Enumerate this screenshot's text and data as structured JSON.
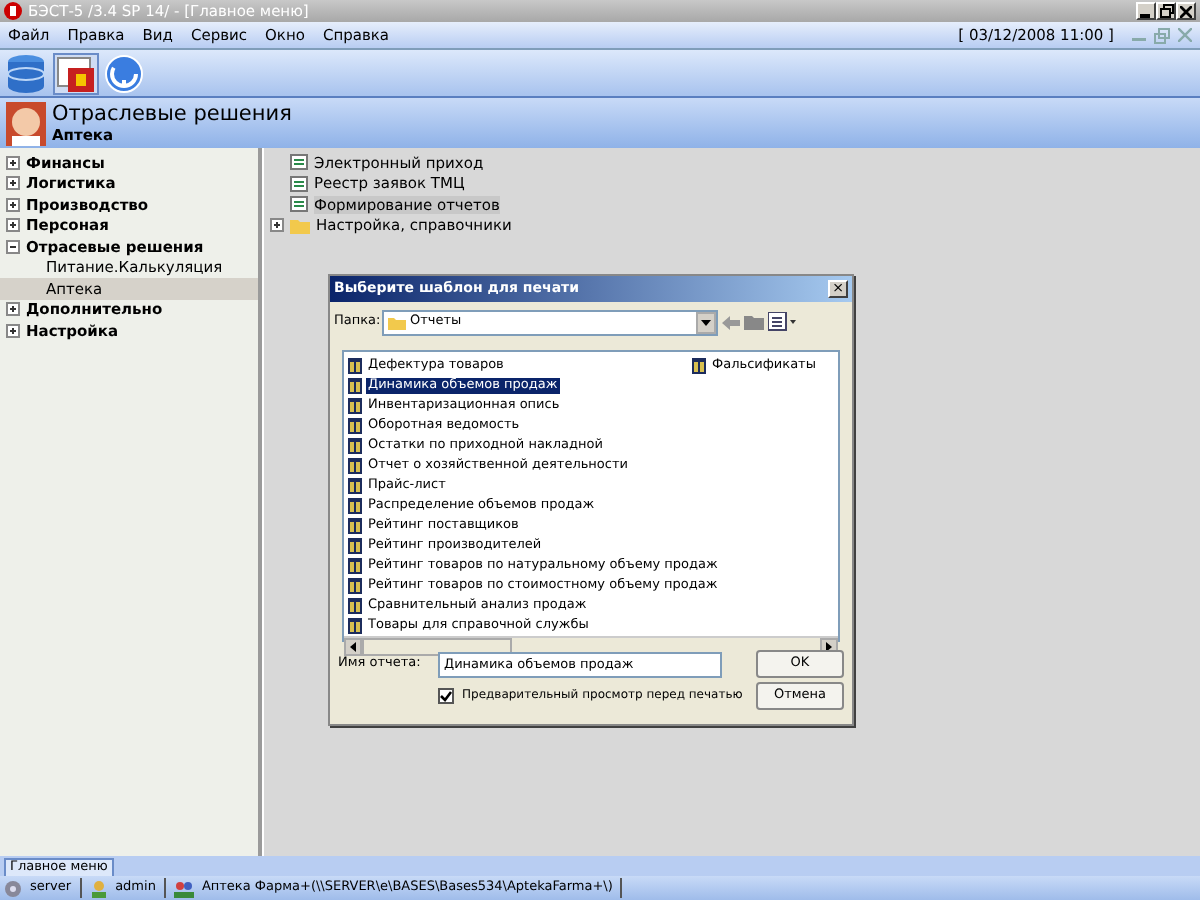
{
  "window": {
    "title": "БЭСТ-5 /3.4 SP 14/ - [Главное меню]"
  },
  "menu": [
    "Файл",
    "Правка",
    "Вид",
    "Сервис",
    "Окно",
    "Справка"
  ],
  "datetime": "[ 03/12/2008 11:00 ]",
  "header": {
    "title": "Отраслевые решения",
    "subtitle": "Аптека"
  },
  "sidebar": {
    "items": [
      {
        "label": "Финансы",
        "expanded": false,
        "selected": false
      },
      {
        "label": "Логистика",
        "expanded": false,
        "selected": false
      },
      {
        "label": "Производство",
        "expanded": false,
        "selected": false
      },
      {
        "label": "Персоная",
        "expanded": false,
        "selected": false
      },
      {
        "label": "Отрасевые решения",
        "expanded": true,
        "selected": false,
        "children": [
          {
            "label": "Питание.Калькуляция",
            "selected": false
          },
          {
            "label": "Аптека",
            "selected": true
          }
        ]
      },
      {
        "label": "Дополнительно",
        "expanded": false,
        "selected": false
      },
      {
        "label": "Настройка",
        "expanded": false,
        "selected": false
      }
    ]
  },
  "content": {
    "items": [
      {
        "kind": "task",
        "label": "Электронный приход",
        "selected": false
      },
      {
        "kind": "task",
        "label": "Реестр заявок ТМЦ",
        "selected": false
      },
      {
        "kind": "task",
        "label": "Формирование отчетов",
        "selected": true
      },
      {
        "kind": "folder",
        "label": "Настройка, справочники",
        "selected": false,
        "expanded": false
      }
    ]
  },
  "dialog": {
    "title": "Выберите шаблон для печати",
    "close": "×",
    "folder_label": "Папка:",
    "folder": "Отчеты",
    "files": [
      {
        "label": "Дефектура товаров",
        "selected": false
      },
      {
        "label": "Динамика объемов продаж",
        "selected": true
      },
      {
        "label": "Инвентаризационная опись",
        "selected": false
      },
      {
        "label": "Оборотная ведомость",
        "selected": false
      },
      {
        "label": "Остатки по приходной накладной",
        "selected": false
      },
      {
        "label": "Отчет о хозяйственной деятельности",
        "selected": false
      },
      {
        "label": "Прайс-лист",
        "selected": false
      },
      {
        "label": "Распределение объемов продаж",
        "selected": false
      },
      {
        "label": "Рейтинг поставщиков",
        "selected": false
      },
      {
        "label": "Рейтинг производителей",
        "selected": false
      },
      {
        "label": "Рейтинг товаров по натуральному объему продаж",
        "selected": false
      },
      {
        "label": "Рейтинг товаров по стоимостному объему продаж",
        "selected": false
      },
      {
        "label": "Сравнительный анализ продаж",
        "selected": false
      },
      {
        "label": "Товары для справочной службы",
        "selected": false
      },
      {
        "label": "Фальсификаты",
        "selected": false
      }
    ],
    "name_label": "Имя отчета:",
    "name_value": "Динамика объемов продаж",
    "preview": {
      "label": "Предварительный просмотр перед печатью",
      "checked": true
    },
    "buttons": [
      "OK",
      "Отмена"
    ]
  },
  "bottom_tab": "Главное меню",
  "status_bar": [
    "server",
    "admin",
    "Аптека Фарма+(\\\\SERVER\\e\\BASES\\Bases534\\AptekaFarma+\\)"
  ]
}
